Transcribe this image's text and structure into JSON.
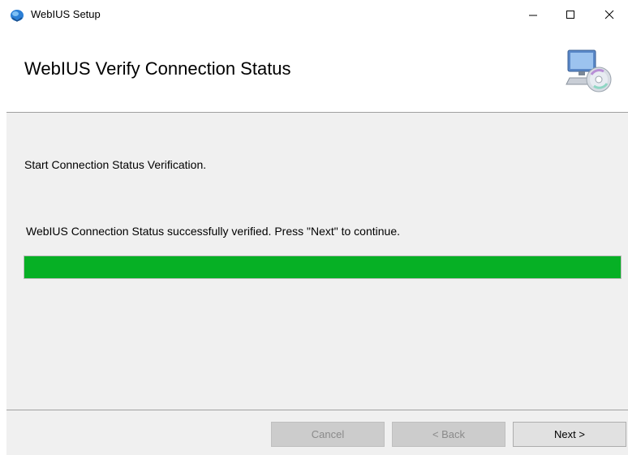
{
  "window": {
    "title": "WebIUS Setup",
    "controls": {
      "minimize": "minimize-icon",
      "maximize": "maximize-icon",
      "close": "close-icon"
    }
  },
  "header": {
    "title": "WebIUS Verify Connection Status",
    "icon": "computer-disc-icon"
  },
  "body": {
    "start_text": "Start Connection Status Verification.",
    "status_text": "WebIUS Connection Status successfully verified. Press \"Next\" to continue.",
    "progress": 1.0,
    "progress_color": "#06b025"
  },
  "footer": {
    "cancel_label": "Cancel",
    "back_label": "< Back",
    "next_label": "Next >"
  }
}
